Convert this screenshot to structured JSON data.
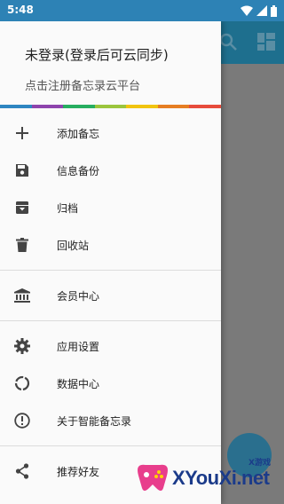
{
  "status": {
    "time": "5:48"
  },
  "drawer": {
    "header_title": "未登录(登录后可云同步)",
    "header_subtitle": "点击注册备忘录云平台",
    "rainbow_colors": [
      "#2e86c1",
      "#8e44ad",
      "#27ae60",
      "#9bc53d",
      "#f1c40f",
      "#e67e22",
      "#e74c3c"
    ],
    "groups": [
      [
        {
          "label": "添加备忘",
          "icon": "plus-icon"
        },
        {
          "label": "信息备份",
          "icon": "save-icon"
        },
        {
          "label": "归档",
          "icon": "archive-icon"
        },
        {
          "label": "回收站",
          "icon": "trash-icon"
        }
      ],
      [
        {
          "label": "会员中心",
          "icon": "bank-icon"
        }
      ],
      [
        {
          "label": "应用设置",
          "icon": "gear-icon"
        },
        {
          "label": "数据中心",
          "icon": "data-ring-icon"
        },
        {
          "label": "关于智能备忘录",
          "icon": "info-icon"
        }
      ],
      [
        {
          "label": "推荐好友",
          "icon": "share-icon"
        }
      ]
    ]
  },
  "watermark": {
    "brand": "XYouXi.net",
    "tag": "X游戏"
  },
  "colors": {
    "status_bar": "#2d82b5",
    "toolbar": "#1e6f8e",
    "scrim": "#7a7a7a",
    "icon": "#444444"
  }
}
